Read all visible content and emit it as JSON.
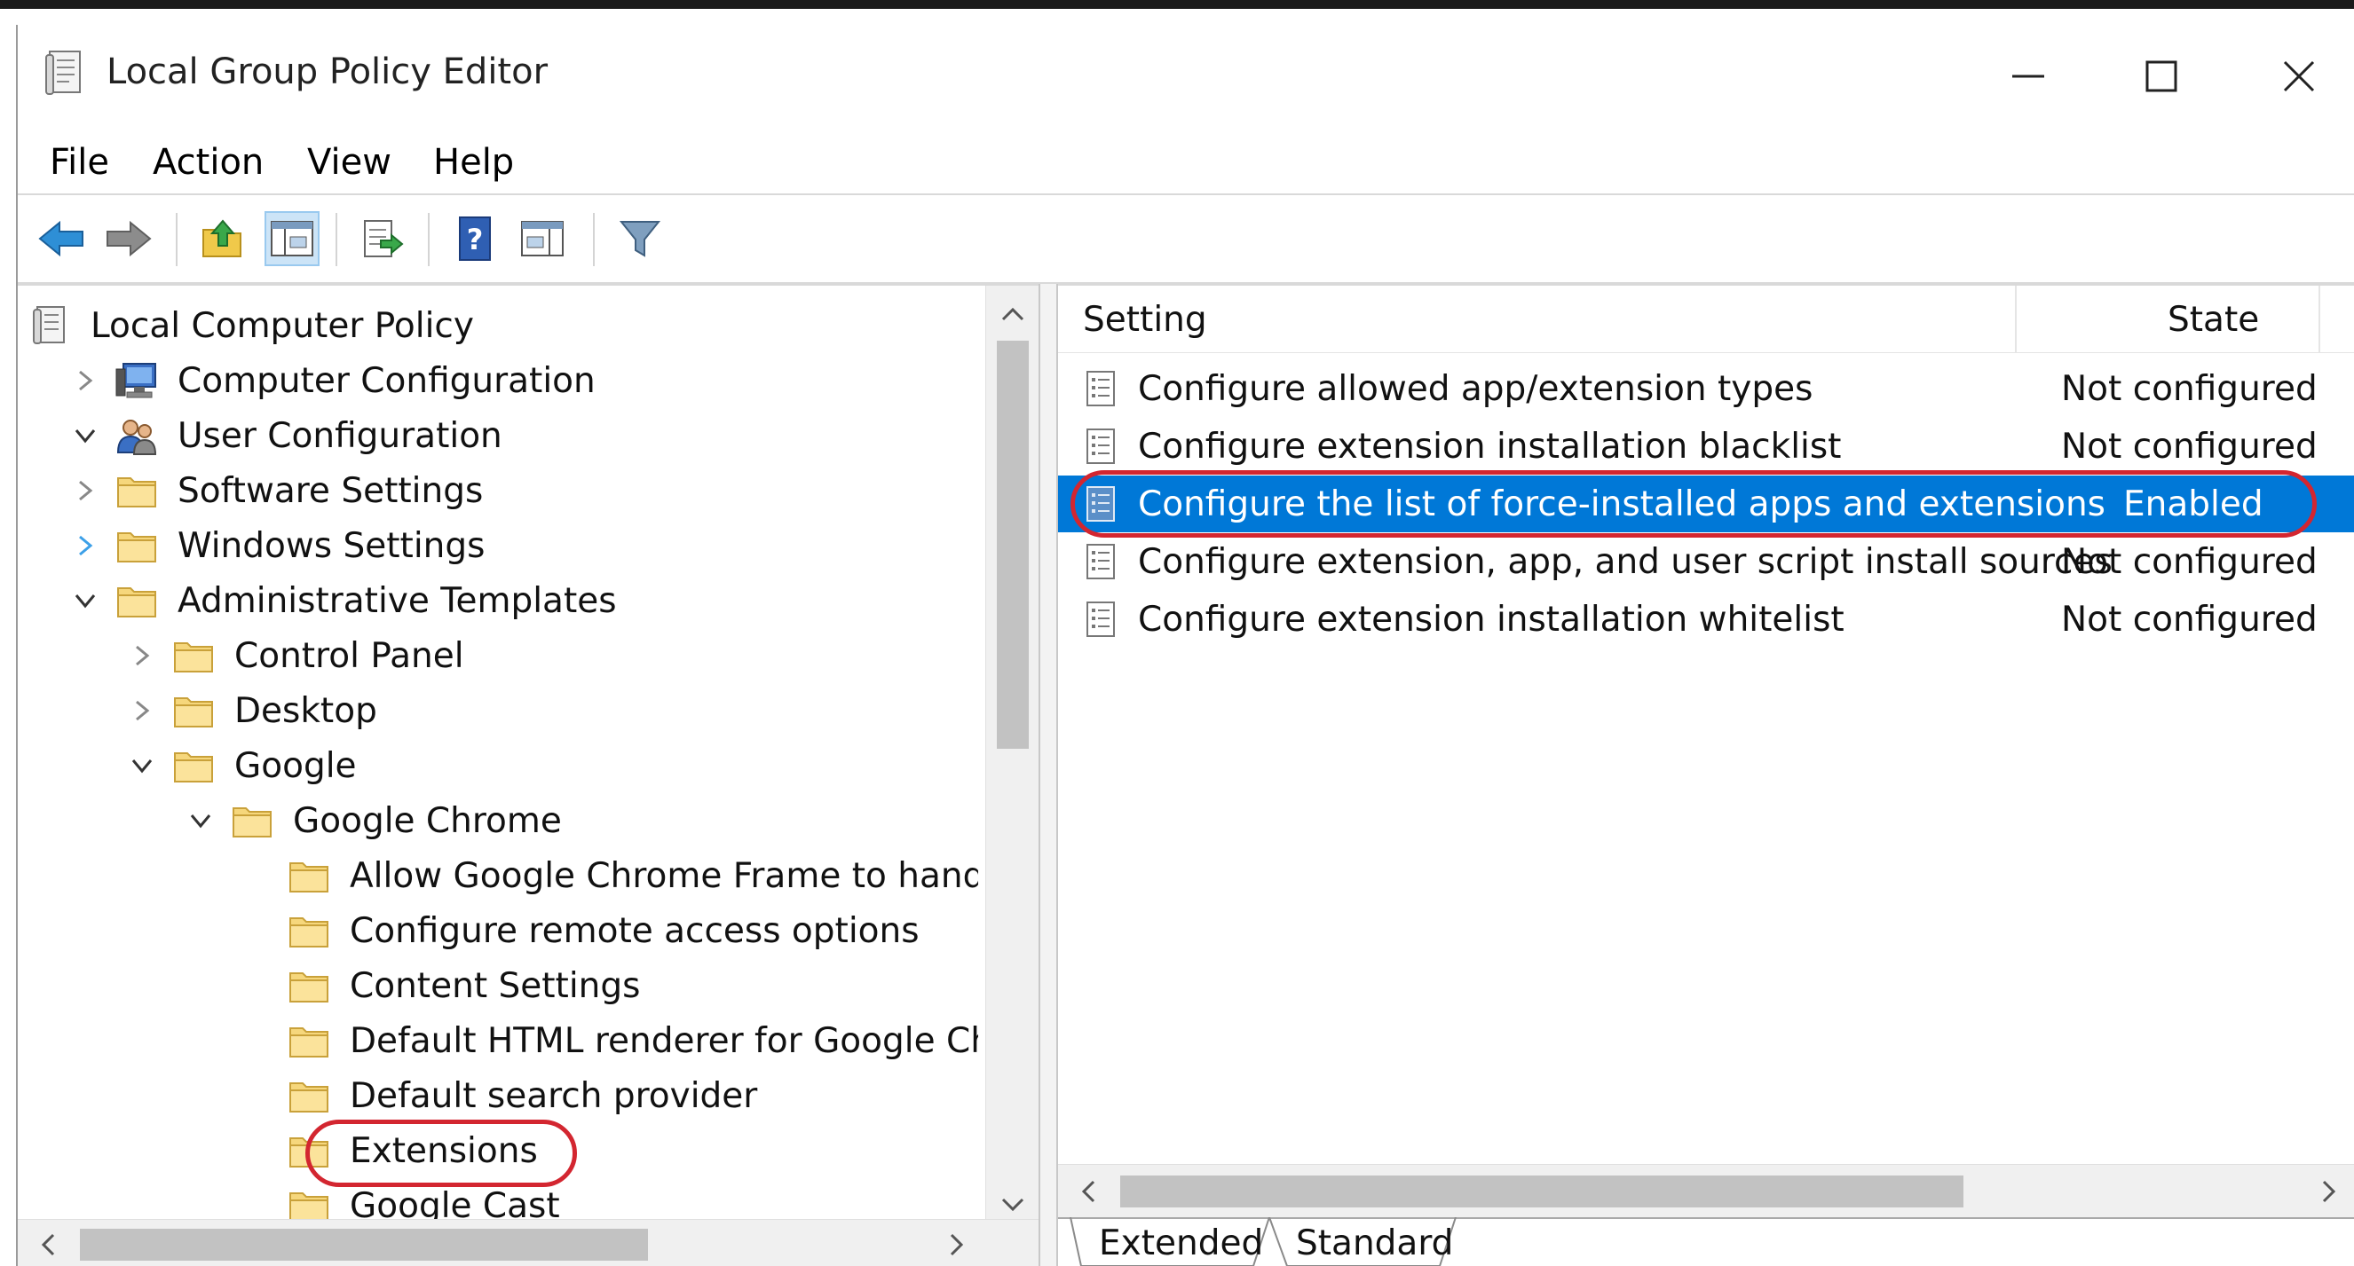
{
  "window": {
    "title": "Local Group Policy Editor",
    "minimize_label": "Minimize",
    "maximize_label": "Maximize",
    "close_label": "Close"
  },
  "menu": {
    "items": [
      "File",
      "Action",
      "View",
      "Help"
    ]
  },
  "toolbar": {
    "buttons": [
      "back-icon",
      "forward-icon",
      "up-folder-icon",
      "show-hide-tree-icon",
      "export-list-icon",
      "help-icon",
      "show-hide-action-pane-icon",
      "filter-icon"
    ]
  },
  "tree": {
    "items": [
      {
        "label": "Local Computer Policy",
        "level": 0,
        "expander": "none",
        "icon": "policy-icon"
      },
      {
        "label": "Computer Configuration",
        "level": 1,
        "expander": "collapsed",
        "icon": "computer-icon"
      },
      {
        "label": "User Configuration",
        "level": 1,
        "expander": "expanded",
        "icon": "users-icon"
      },
      {
        "label": "Software Settings",
        "level": 2,
        "expander": "collapsed",
        "icon": "folder-icon"
      },
      {
        "label": "Windows Settings",
        "level": 2,
        "expander": "collapsed-hover",
        "icon": "folder-icon"
      },
      {
        "label": "Administrative Templates",
        "level": 2,
        "expander": "expanded",
        "icon": "folder-icon"
      },
      {
        "label": "Control Panel",
        "level": 3,
        "expander": "collapsed",
        "icon": "folder-icon"
      },
      {
        "label": "Desktop",
        "level": 3,
        "expander": "collapsed",
        "icon": "folder-icon"
      },
      {
        "label": "Google",
        "level": 3,
        "expander": "expanded",
        "icon": "folder-icon"
      },
      {
        "label": "Google Chrome",
        "level": 4,
        "expander": "expanded",
        "icon": "folder-icon"
      },
      {
        "label": "Allow Google Chrome Frame to hand",
        "level": 5,
        "expander": "none",
        "icon": "folder-icon"
      },
      {
        "label": "Configure remote access options",
        "level": 5,
        "expander": "none",
        "icon": "folder-icon"
      },
      {
        "label": "Content Settings",
        "level": 5,
        "expander": "none",
        "icon": "folder-icon"
      },
      {
        "label": "Default HTML renderer for Google Ch",
        "level": 5,
        "expander": "none",
        "icon": "folder-icon"
      },
      {
        "label": "Default search provider",
        "level": 5,
        "expander": "none",
        "icon": "folder-icon"
      },
      {
        "label": "Extensions",
        "level": 5,
        "expander": "none",
        "icon": "folder-icon"
      },
      {
        "label": "Google Cast",
        "level": 5,
        "expander": "none",
        "icon": "folder-icon"
      }
    ]
  },
  "list": {
    "columns": {
      "setting": "Setting",
      "state": "State"
    },
    "rows": [
      {
        "setting": "Configure allowed app/extension types",
        "state": "Not configured",
        "selected": false
      },
      {
        "setting": "Configure extension installation blacklist",
        "state": "Not configured",
        "selected": false
      },
      {
        "setting": "Configure the list of force-installed apps and extensions",
        "state": "Enabled",
        "selected": true
      },
      {
        "setting": "Configure extension, app, and user script install sources",
        "state": "Not configured",
        "selected": false
      },
      {
        "setting": "Configure extension installation whitelist",
        "state": "Not configured",
        "selected": false
      }
    ]
  },
  "tabs": {
    "extended": "Extended",
    "standard": "Standard"
  },
  "colors": {
    "selection": "#0078d7",
    "annotation": "#d32630",
    "folder": "#f6d77c"
  }
}
